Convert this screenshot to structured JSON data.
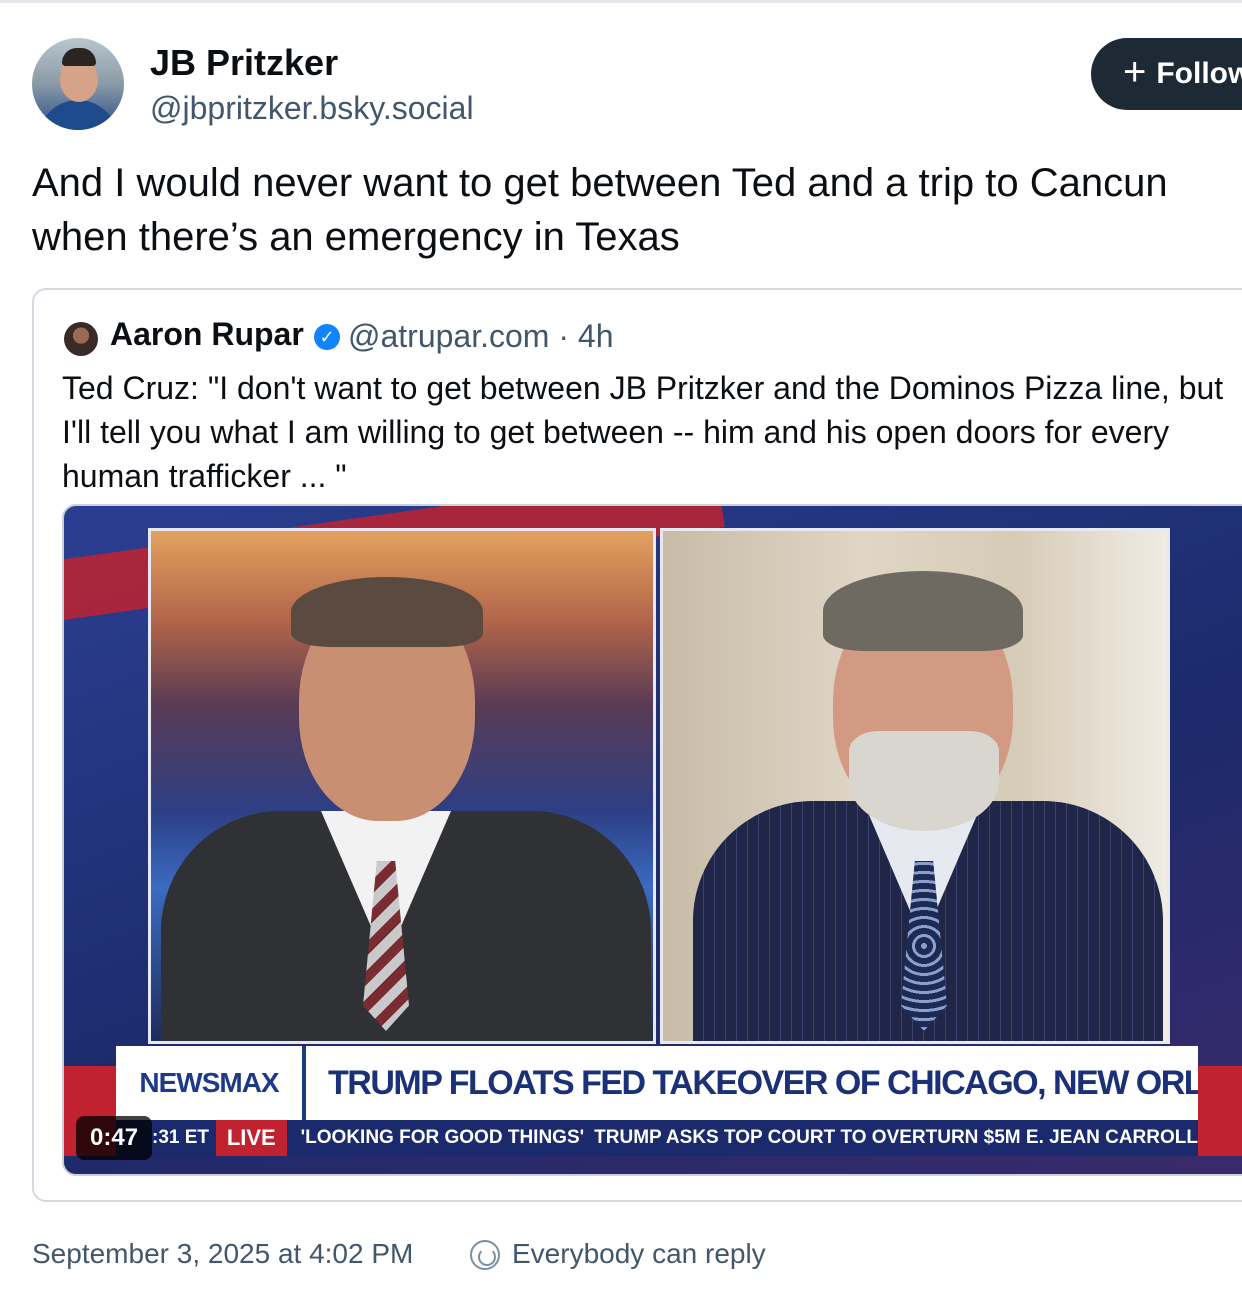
{
  "post": {
    "author": {
      "display_name": "JB Pritzker",
      "handle": "@jbpritzker.bsky.social"
    },
    "follow_label": "Follow",
    "text_line1": "And I would never want to get between Ted and a trip to Cancun",
    "text_line2": "when there’s an emergency in Texas",
    "timestamp": "September 3, 2025 at 4:02 PM",
    "reply_setting": "Everybody can reply"
  },
  "quote": {
    "author_name": "Aaron Rupar",
    "meta": "@atrupar.com · 4h",
    "text": "Ted Cruz: \"I don't want to get between JB Pritzker and the Dominos Pizza line, but I'll tell you what I am willing to get between -- him and his open doors for every human trafficker ... \"",
    "video": {
      "duration": "0:47",
      "chyron_brand": "NEWSMAX",
      "chyron_headline": "TRUMP FLOATS FED TAKEOVER OF CHICAGO, NEW ORLEANS",
      "ticker_clock": ":31 ET",
      "ticker_live": "LIVE",
      "ticker_item1": "'LOOKING FOR GOOD THINGS'",
      "ticker_item2": "TRUMP ASKS TOP COURT TO OVERTURN $5M E. JEAN CARROLL"
    }
  },
  "icons": {
    "follow": "plus-icon",
    "verified": "verified-badge-icon",
    "reply": "reply-setting-icon"
  },
  "colors": {
    "follow_bg": "#1e2936",
    "verified": "#1083fe",
    "muted_text": "#42576c"
  }
}
